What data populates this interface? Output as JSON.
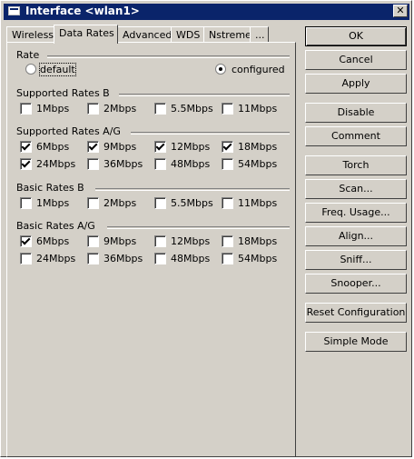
{
  "window": {
    "title": "Interface <wlan1>"
  },
  "tabs": [
    "Wireless",
    "Data Rates",
    "Advanced",
    "WDS",
    "Nstreme",
    "..."
  ],
  "rate": {
    "label": "Rate",
    "options": [
      "default",
      "configured"
    ],
    "selected": "configured"
  },
  "groups": [
    {
      "title": "Supported Rates B",
      "rows": [
        [
          [
            "1Mbps",
            false
          ],
          [
            "2Mbps",
            false
          ],
          [
            "5.5Mbps",
            false
          ],
          [
            "11Mbps",
            false
          ]
        ]
      ]
    },
    {
      "title": "Supported Rates A/G",
      "rows": [
        [
          [
            "6Mbps",
            true
          ],
          [
            "9Mbps",
            true
          ],
          [
            "12Mbps",
            true
          ],
          [
            "18Mbps",
            true
          ]
        ],
        [
          [
            "24Mbps",
            true
          ],
          [
            "36Mbps",
            false
          ],
          [
            "48Mbps",
            false
          ],
          [
            "54Mbps",
            false
          ]
        ]
      ]
    },
    {
      "title": "Basic Rates B",
      "rows": [
        [
          [
            "1Mbps",
            false
          ],
          [
            "2Mbps",
            false
          ],
          [
            "5.5Mbps",
            false
          ],
          [
            "11Mbps",
            false
          ]
        ]
      ]
    },
    {
      "title": "Basic Rates A/G",
      "rows": [
        [
          [
            "6Mbps",
            true
          ],
          [
            "9Mbps",
            false
          ],
          [
            "12Mbps",
            false
          ],
          [
            "18Mbps",
            false
          ]
        ],
        [
          [
            "24Mbps",
            false
          ],
          [
            "36Mbps",
            false
          ],
          [
            "48Mbps",
            false
          ],
          [
            "54Mbps",
            false
          ]
        ]
      ]
    }
  ],
  "buttons": [
    "OK",
    "Cancel",
    "Apply",
    "Disable",
    "Comment",
    "Torch",
    "Scan...",
    "Freq. Usage...",
    "Align...",
    "Sniff...",
    "Snooper...",
    "Reset Configuration",
    "Simple Mode"
  ],
  "close_symbol": "✕"
}
